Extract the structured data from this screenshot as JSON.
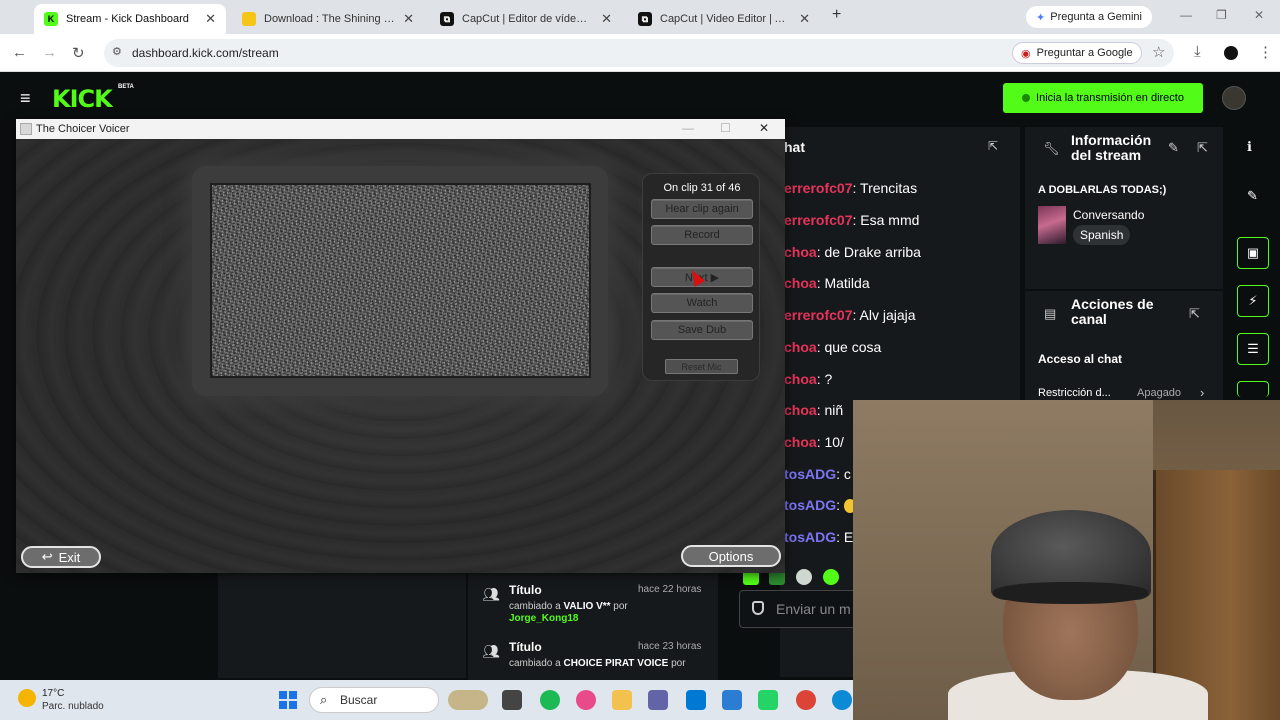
{
  "browser": {
    "tabs": [
      {
        "title": "Stream - Kick Dashboard",
        "active": true
      },
      {
        "title": "Download : The Shining - Here's",
        "active": false
      },
      {
        "title": "CapCut | Editor de vídeo todo e",
        "active": false
      },
      {
        "title": "CapCut | Video Editor | All-In-O",
        "active": false
      }
    ],
    "gemini_label": "Pregunta a Gemini",
    "url": "dashboard.kick.com/stream",
    "ask_google_label": "Preguntar a Google"
  },
  "kick": {
    "logo": "KICK",
    "beta": "BETA",
    "go_live_label": "Inicia la transmisión en directo",
    "accent": "#53fc18",
    "chat": {
      "title": "hat",
      "messages": [
        {
          "user": "errerofc07",
          "text": "Trencitas",
          "color": "#e8335a"
        },
        {
          "user": "errerofc07",
          "text": "Esa mmd",
          "color": "#e8335a"
        },
        {
          "user": "choa",
          "text": "de Drake arriba",
          "color": "#e8335a"
        },
        {
          "user": "choa",
          "text": "Matilda",
          "color": "#e8335a"
        },
        {
          "user": "errerofc07",
          "text": "Alv jajaja",
          "color": "#e8335a"
        },
        {
          "user": "choa",
          "text": "que cosa",
          "color": "#e8335a"
        },
        {
          "user": "choa",
          "text": "?",
          "color": "#e8335a"
        },
        {
          "user": "choa",
          "text": "niñ",
          "color": "#e8335a"
        },
        {
          "user": "choa",
          "text": "10/",
          "color": "#e8335a"
        },
        {
          "user": "tosADG",
          "text": "c",
          "color": "#7b74f5"
        },
        {
          "user": "tosADG",
          "text": "",
          "color": "#7b74f5"
        },
        {
          "user": "tosADG",
          "text": "E",
          "color": "#7b74f5"
        }
      ],
      "input_placeholder": "Enviar un m"
    },
    "info": {
      "title_line1": "Información",
      "title_line2": "del stream",
      "stream_title": "A DOBLARLAS TODAS;)",
      "category": "Conversando",
      "language": "Spanish"
    },
    "actions": {
      "title_line1": "Acciones de",
      "title_line2": "canal",
      "chat_access": "Acceso al chat",
      "restriction_label": "Restricción d...",
      "restriction_value": "Apagado"
    },
    "feed": [
      {
        "title": "Título",
        "time": "hace 22 horas",
        "prefix": "cambiado a ",
        "value": "VALIO V**",
        "suffix": " por",
        "user": "Jorge_Kong18"
      },
      {
        "title": "Título",
        "time": "hace 23 horas",
        "prefix": "cambiado a ",
        "value": "CHOICE PIRAT VOICE",
        "suffix": " por",
        "user": ""
      }
    ]
  },
  "choicer": {
    "window_title": "The Choicer Voicer",
    "clip_status": "On clip 31 of 46",
    "buttons": {
      "hear": "Hear clip again",
      "record": "Record",
      "next": "Next ▶",
      "watch": "Watch",
      "save": "Save Dub",
      "reset_mic": "Reset Mic"
    },
    "exit_label": "Exit",
    "options_label": "Options"
  },
  "taskbar": {
    "temperature": "17°C",
    "condition": "Parc. nublado",
    "search_label": "Buscar"
  }
}
